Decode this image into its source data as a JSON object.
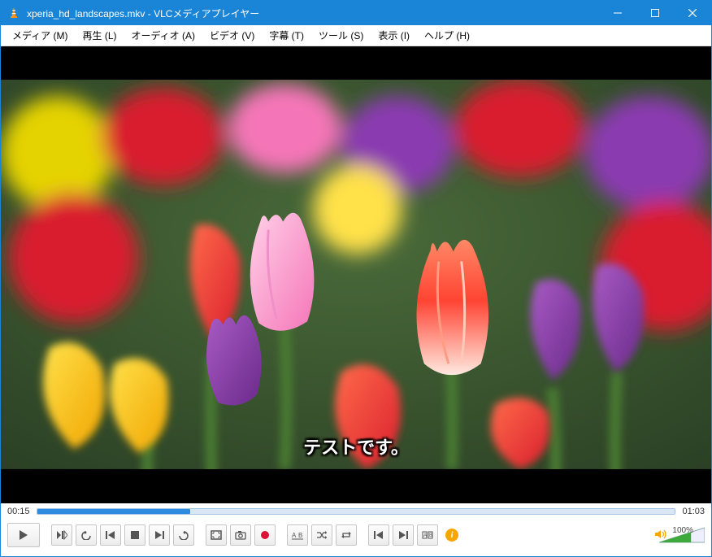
{
  "window": {
    "title": "xperia_hd_landscapes.mkv - VLCメディアプレイヤー"
  },
  "menu": {
    "items": [
      "メディア (M)",
      "再生 (L)",
      "オーディオ (A)",
      "ビデオ (V)",
      "字幕 (T)",
      "ツール (S)",
      "表示 (I)",
      "ヘルプ (H)"
    ]
  },
  "video": {
    "subtitle": "テストです。"
  },
  "playback": {
    "current_time": "00:15",
    "total_time": "01:03",
    "progress_pct": 24
  },
  "volume": {
    "percent_label": "100%",
    "level_pct": 70
  }
}
